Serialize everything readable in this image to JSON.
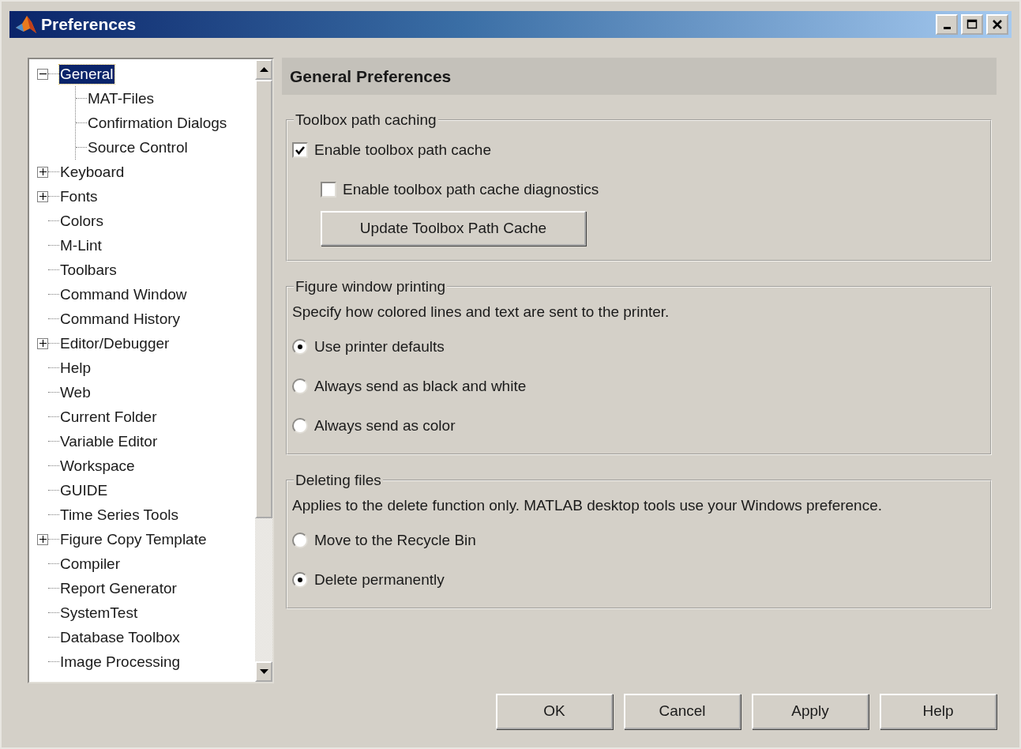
{
  "window": {
    "title": "Preferences"
  },
  "tree": {
    "items": [
      {
        "label": "General",
        "selected": true,
        "expanded": true,
        "children": [
          {
            "label": "MAT-Files",
            "selected": false
          },
          {
            "label": "Confirmation Dialogs",
            "selected": false
          },
          {
            "label": "Source Control",
            "selected": false
          }
        ]
      },
      {
        "label": "Keyboard",
        "selected": false,
        "expanded": false
      },
      {
        "label": "Fonts",
        "selected": false,
        "expanded": false
      },
      {
        "label": "Colors",
        "selected": false
      },
      {
        "label": "M-Lint",
        "selected": false
      },
      {
        "label": "Toolbars",
        "selected": false
      },
      {
        "label": "Command Window",
        "selected": false
      },
      {
        "label": "Command History",
        "selected": false
      },
      {
        "label": "Editor/Debugger",
        "selected": false,
        "expanded": false
      },
      {
        "label": "Help",
        "selected": false
      },
      {
        "label": "Web",
        "selected": false
      },
      {
        "label": "Current Folder",
        "selected": false
      },
      {
        "label": "Variable Editor",
        "selected": false
      },
      {
        "label": "Workspace",
        "selected": false
      },
      {
        "label": "GUIDE",
        "selected": false
      },
      {
        "label": "Time Series Tools",
        "selected": false
      },
      {
        "label": "Figure Copy Template",
        "selected": false,
        "expanded": false
      },
      {
        "label": "Compiler",
        "selected": false
      },
      {
        "label": "Report Generator",
        "selected": false
      },
      {
        "label": "SystemTest",
        "selected": false
      },
      {
        "label": "Database Toolbox",
        "selected": false
      },
      {
        "label": "Image Processing",
        "selected": false
      }
    ]
  },
  "panel": {
    "title": "General Preferences",
    "groups": [
      {
        "title": "Toolbox path caching",
        "items": [
          {
            "kind": "checkbox",
            "label": "Enable toolbox path cache",
            "checked": true,
            "children": [
              {
                "kind": "checkbox",
                "label": "Enable toolbox path cache diagnostics",
                "checked": false
              }
            ]
          },
          {
            "kind": "button",
            "label": "Update Toolbox Path Cache"
          }
        ]
      },
      {
        "title": "Figure window printing",
        "items": [
          {
            "kind": "text",
            "label": "Specify how colored lines and text are sent to the printer."
          },
          {
            "kind": "radio",
            "label": "Use printer defaults",
            "selected": true
          },
          {
            "kind": "radio",
            "label": "Always send as black and white",
            "selected": false
          },
          {
            "kind": "radio",
            "label": "Always send as color",
            "selected": false
          }
        ]
      },
      {
        "title": "Deleting files",
        "items": [
          {
            "kind": "text",
            "label": "Applies to the delete function only. MATLAB desktop tools use your Windows preference."
          },
          {
            "kind": "radio",
            "label": "Move to the Recycle Bin",
            "selected": false
          },
          {
            "kind": "radio",
            "label": "Delete permanently",
            "selected": true
          }
        ]
      }
    ]
  },
  "buttons": [
    "OK",
    "Cancel",
    "Apply",
    "Help"
  ]
}
